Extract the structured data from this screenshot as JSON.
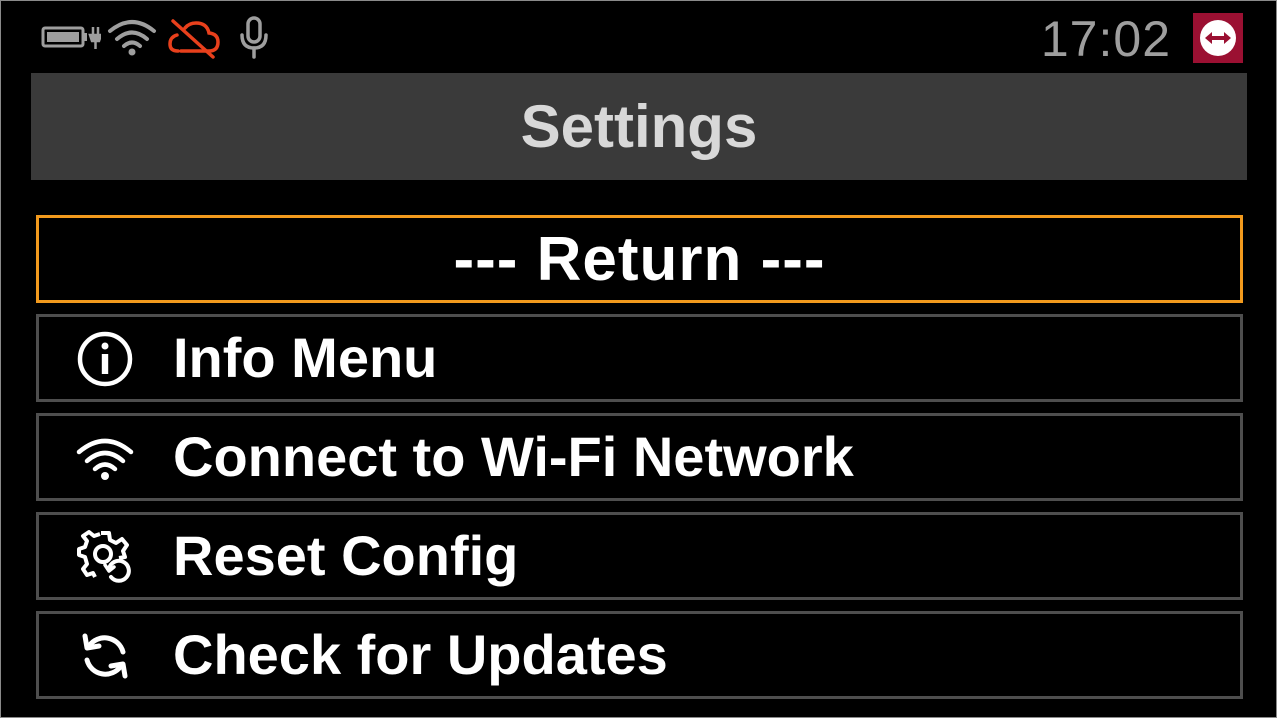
{
  "status_bar": {
    "icons": [
      "battery-charging-icon",
      "wifi-icon",
      "cloud-off-icon",
      "microphone-icon"
    ],
    "time": "17:02",
    "app_logo": "teamviewer-logo-icon",
    "colors": {
      "cloud_off": "#e8401c",
      "logo_bg": "#9b1032",
      "icon_gray": "#9e9e9e"
    }
  },
  "header": {
    "title": "Settings"
  },
  "menu": {
    "items": [
      {
        "label": "--- Return ---",
        "icon": "",
        "selected": true
      },
      {
        "label": "Info Menu",
        "icon": "info-icon",
        "selected": false
      },
      {
        "label": "Connect to Wi-Fi Network",
        "icon": "wifi-icon",
        "selected": false
      },
      {
        "label": "Reset Config",
        "icon": "gear-reset-icon",
        "selected": false
      },
      {
        "label": "Check for Updates",
        "icon": "refresh-icon",
        "selected": false
      }
    ],
    "colors": {
      "selected_border": "#f29a1d",
      "border": "#4e4e4e"
    }
  }
}
